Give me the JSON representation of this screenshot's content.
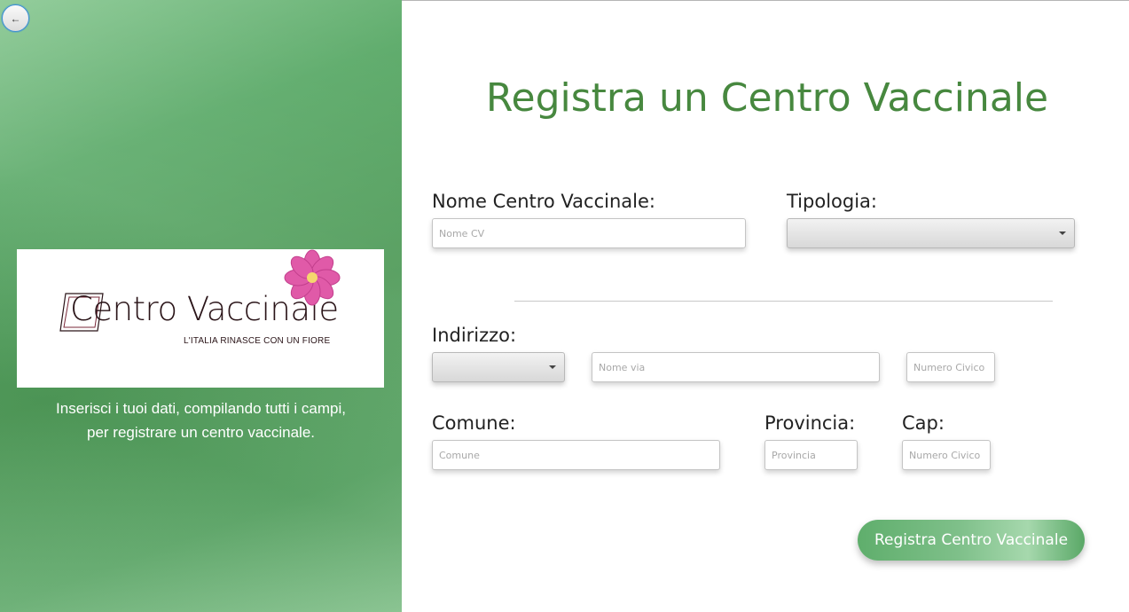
{
  "nav": {
    "back_label": "←"
  },
  "logo": {
    "title": "Centro Vaccinale",
    "tagline": "L'ITALIA RINASCE CON UN FIORE"
  },
  "left_caption": {
    "line1": "Inserisci i tuoi dati, compilando tutti i campi,",
    "line2": "per registrare un centro vaccinale."
  },
  "form": {
    "title": "Registra un Centro Vaccinale",
    "nome_label": "Nome Centro Vaccinale:",
    "nome_placeholder": "Nome CV",
    "tipologia_label": "Tipologia:",
    "tipologia_value": "",
    "indirizzo_label": "Indirizzo:",
    "qualificatore_value": "",
    "via_placeholder": "Nome via",
    "civico_placeholder": "Numero Civico",
    "comune_label": "Comune:",
    "comune_placeholder": "Comune",
    "provincia_label": "Provincia:",
    "provincia_placeholder": "Provincia",
    "cap_label": "Cap:",
    "cap_placeholder": "Numero Civico",
    "submit_label": "Registra Centro Vaccinale"
  },
  "colors": {
    "accent_green": "#47883f",
    "panel_green": "#5fa96a",
    "focus_blue": "#3c8fd6",
    "flower_pink": "#e05aa8",
    "flower_center": "#f5d76e"
  },
  "icons": {
    "back": "back-arrow-icon",
    "dropdown": "chevron-down-icon",
    "logo_flower": "flower-icon"
  }
}
